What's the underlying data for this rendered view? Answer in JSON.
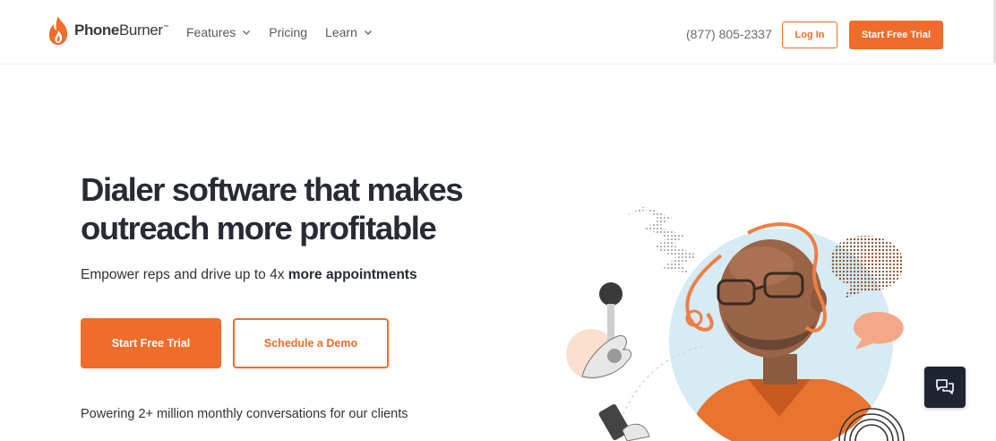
{
  "brand": {
    "name_bold": "Phone",
    "name_light": "Burner",
    "trademark": "™",
    "accent_color": "#ef6c2a",
    "logo_icon": "flame-icon"
  },
  "nav": {
    "items": [
      {
        "label": "Features",
        "has_dropdown": true
      },
      {
        "label": "Pricing",
        "has_dropdown": false
      },
      {
        "label": "Learn",
        "has_dropdown": true
      }
    ]
  },
  "header": {
    "phone": "(877) 805-2337",
    "login_label": "Log In",
    "trial_label": "Start Free Trial"
  },
  "hero": {
    "title_line1": "Dialer software that makes",
    "title_line2": "outreach more profitable",
    "subtitle_prefix": "Empower reps and drive up to 4x ",
    "subtitle_bold": "more appointments",
    "primary_cta": "Start Free Trial",
    "secondary_cta": "Schedule a Demo",
    "powering_text": "Powering 2+ million monthly conversations for our clients"
  },
  "chat": {
    "icon": "chat-bubbles-icon"
  }
}
